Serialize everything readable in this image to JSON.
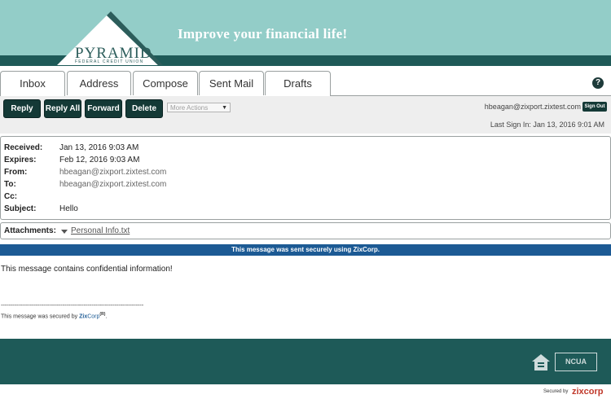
{
  "header": {
    "logo_name": "PYRAMID",
    "logo_sub": "FEDERAL CREDIT UNION",
    "tagline": "Improve your financial life!"
  },
  "tabs": [
    {
      "label": "Inbox",
      "active": true
    },
    {
      "label": "Address",
      "active": false
    },
    {
      "label": "Compose",
      "active": false
    },
    {
      "label": "Sent Mail",
      "active": false
    },
    {
      "label": "Drafts",
      "active": false
    }
  ],
  "help_label": "?",
  "toolbar": {
    "reply": "Reply",
    "reply_all": "Reply All",
    "forward": "Forward",
    "delete": "Delete",
    "more_actions": "More Actions",
    "user_email": "hbeagan@zixport.zixtest.com",
    "sign_out": "Sign Out",
    "last_sign_in": "Last Sign In: Jan 13, 2016 9:01 AM"
  },
  "message": {
    "fields": [
      {
        "label": "Received:",
        "value": "Jan 13, 2016 9:03 AM"
      },
      {
        "label": "Expires:",
        "value": "Feb 12, 2016 9:03 AM"
      },
      {
        "label": "From:",
        "value": "hbeagan@zixport.zixtest.com"
      },
      {
        "label": "To:",
        "value": "hbeagan@zixport.zixtest.com"
      },
      {
        "label": "Cc:",
        "value": ""
      },
      {
        "label": "Subject:",
        "value": "Hello"
      }
    ],
    "attachments_label": "Attachments:",
    "attachment_name": "Personal Info.txt",
    "secure_banner": "This message was sent securely using ZixCorp.",
    "body": "This message contains confidential information!",
    "separator": "--------------------------------------------------------------------------",
    "secured_prefix": "This message was secured by ",
    "secured_zix": "Zix",
    "secured_corp": "Corp",
    "secured_reg": "(R)",
    "secured_suffix": "."
  },
  "footer": {
    "ncua": "NCUA",
    "secured_by": "Secured by",
    "zix_logo": "zixcorp"
  },
  "colors": {
    "banner": "#93cdc8",
    "dark_teal": "#1e5a58",
    "button": "#143936",
    "secure_bar": "#1c5a94"
  }
}
